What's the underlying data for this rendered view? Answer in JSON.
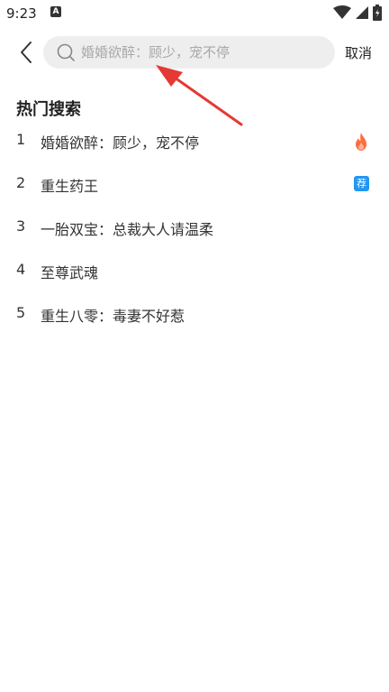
{
  "status_bar": {
    "time": "9:23",
    "notification_letter": "A"
  },
  "search": {
    "placeholder": "婚婚欲醉：顾少，宠不停",
    "value": ""
  },
  "cancel_label": "取消",
  "hot_search": {
    "title": "热门搜索",
    "items": [
      {
        "rank": "1",
        "title": "婚婚欲醉：顾少，宠不停",
        "badge": "fire-icon"
      },
      {
        "rank": "2",
        "title": "重生药王",
        "badge": "荐"
      },
      {
        "rank": "3",
        "title": "一胎双宝：总裁大人请温柔",
        "badge": ""
      },
      {
        "rank": "4",
        "title": "至尊武魂",
        "badge": ""
      },
      {
        "rank": "5",
        "title": "重生八零：毒妻不好惹",
        "badge": ""
      }
    ]
  },
  "colors": {
    "background": "#ffffff",
    "search_box": "#eeeeee",
    "placeholder": "#a8a8a8",
    "fire": "#ff6b3d",
    "recommend_badge": "#2196f3",
    "annotation_arrow": "#e53935"
  }
}
